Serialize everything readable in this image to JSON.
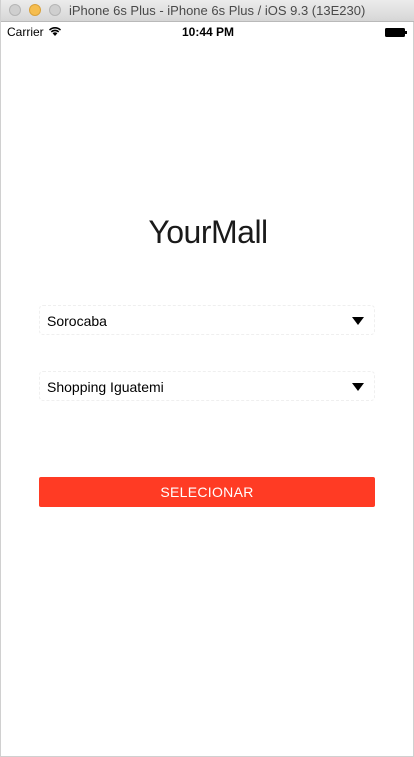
{
  "window": {
    "title": "iPhone 6s Plus - iPhone 6s Plus / iOS 9.3 (13E230)"
  },
  "status_bar": {
    "carrier": "Carrier",
    "time": "10:44 PM",
    "wifi_icon": "wifi-icon",
    "battery_icon": "battery-icon"
  },
  "app": {
    "title": "YourMall",
    "city_picker": {
      "value": "Sorocaba",
      "icon": "caret-down-icon"
    },
    "mall_picker": {
      "value": "Shopping Iguatemi",
      "icon": "caret-down-icon"
    },
    "select_button": {
      "label": "SELECIONAR",
      "color": "#ff3b24"
    }
  }
}
